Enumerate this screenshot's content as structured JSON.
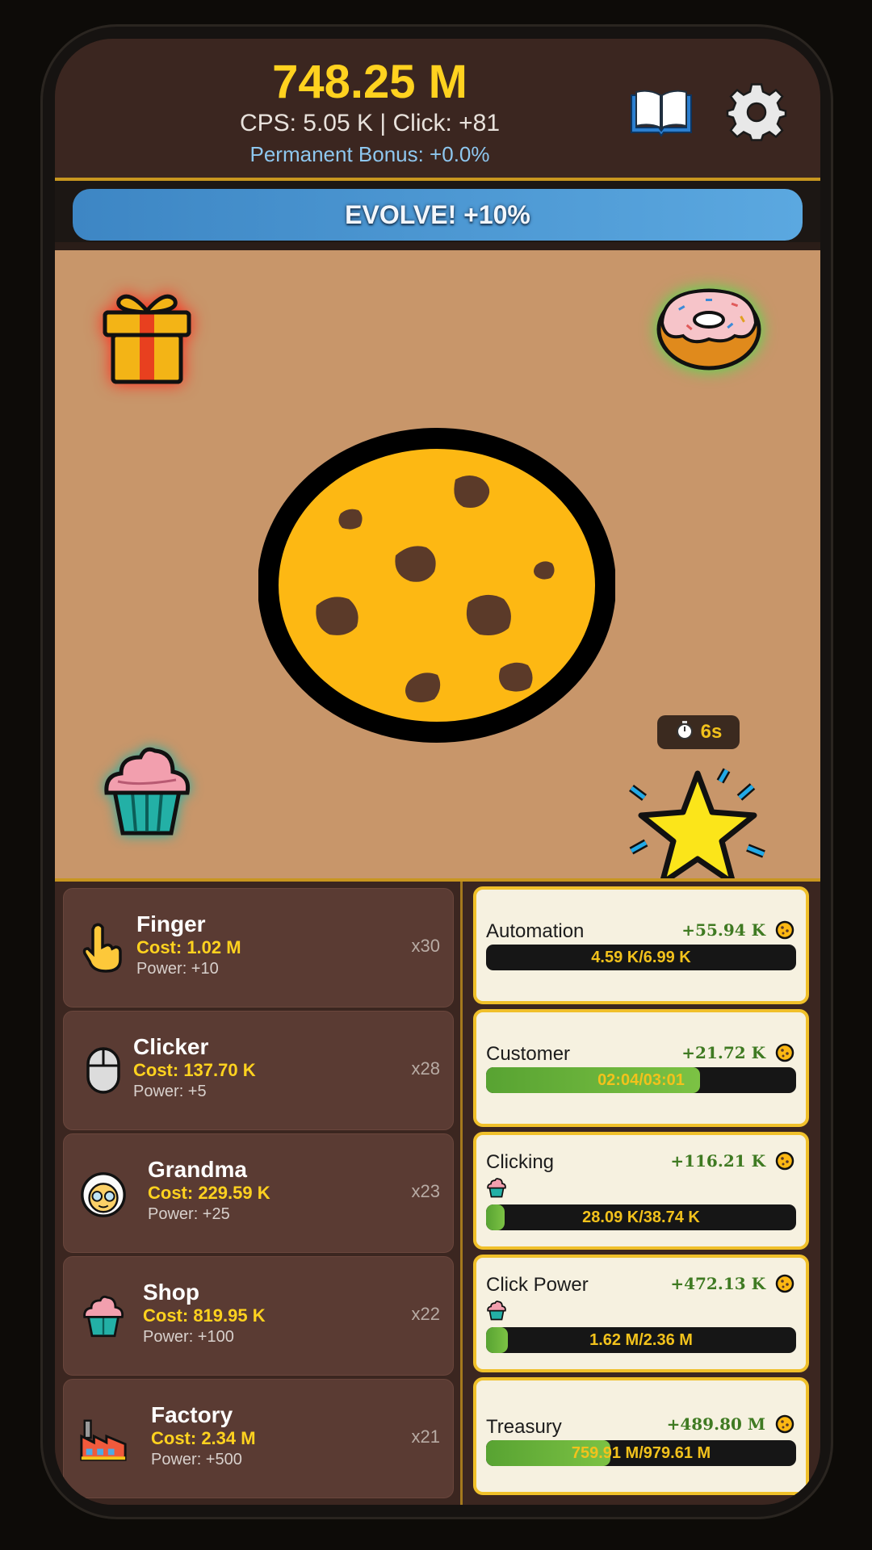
{
  "header": {
    "cookie_count": "748.25 M",
    "cps_line": "CPS: 5.05 K | Click: +81",
    "bonus_line": "Permanent Bonus: +0.0%"
  },
  "evolve": {
    "label": "EVOLVE! +10%"
  },
  "play_area": {
    "timer": "6s",
    "icons": [
      "gift-icon",
      "donut-icon",
      "cookie-icon",
      "cupcake-icon",
      "star-icon",
      "stopwatch-icon"
    ]
  },
  "buildings": [
    {
      "name": "Finger",
      "cost": "Cost: 1.02 M",
      "power": "Power: +10",
      "count": "x30",
      "icon": "pointing-finger-icon"
    },
    {
      "name": "Clicker",
      "cost": "Cost: 137.70 K",
      "power": "Power: +5",
      "count": "x28",
      "icon": "mouse-icon"
    },
    {
      "name": "Grandma",
      "cost": "Cost: 229.59 K",
      "power": "Power: +25",
      "count": "x23",
      "icon": "grandma-icon"
    },
    {
      "name": "Shop",
      "cost": "Cost: 819.95 K",
      "power": "Power: +100",
      "count": "x22",
      "icon": "cupcake-icon"
    },
    {
      "name": "Factory",
      "cost": "Cost: 2.34 M",
      "power": "Power: +500",
      "count": "x21",
      "icon": "factory-icon"
    }
  ],
  "upgrades": [
    {
      "name": "Automation",
      "gain": "+55.94 K",
      "progress_text": "4.59 K/6.99 K",
      "progress": 0.0
    },
    {
      "name": "Customer",
      "gain": "+21.72 K",
      "progress_text": "02:04/03:01",
      "progress": 0.69
    },
    {
      "name": "Clicking",
      "gain": "+116.21 K",
      "progress_text": "28.09 K/38.74 K",
      "progress": 0.06
    },
    {
      "name": "Click Power",
      "gain": "+472.13 K",
      "progress_text": "1.62 M/2.36 M",
      "progress": 0.07
    },
    {
      "name": "Treasury",
      "gain": "+489.80 M",
      "progress_text": "759.91 M/979.61 M",
      "progress": 0.4
    }
  ],
  "colors": {
    "gold": "#ffd21f",
    "evolve_blue": "#4a9ad6",
    "progress_green": "#6ab53c",
    "card_border": "#f0c02a"
  }
}
